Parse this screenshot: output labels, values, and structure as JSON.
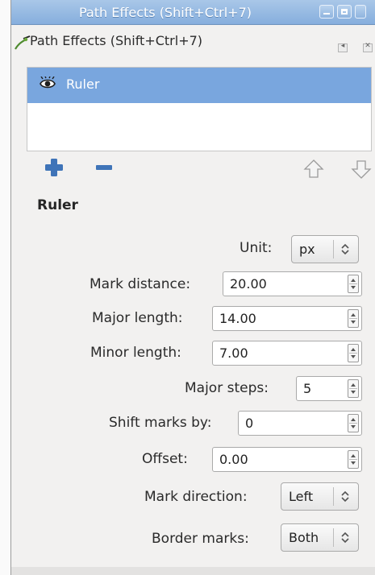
{
  "window": {
    "title": "Path Effects  (Shift+Ctrl+7)"
  },
  "dock": {
    "title": "Path Effects  (Shift+Ctrl+7)",
    "icon": "path-effects-icon"
  },
  "effects": {
    "items": [
      {
        "label": "Ruler",
        "visible": true,
        "selected": true
      }
    ]
  },
  "toolbar": {
    "add_icon": "plus-icon",
    "remove_icon": "minus-icon",
    "up_icon": "raise-icon",
    "down_icon": "lower-icon"
  },
  "section": {
    "title": "Ruler"
  },
  "params": {
    "unit": {
      "label": "Unit:",
      "value": "px"
    },
    "mark_distance": {
      "label": "Mark distance:",
      "value": "20.00"
    },
    "major_length": {
      "label": "Major length:",
      "value": "14.00"
    },
    "minor_length": {
      "label": "Minor length:",
      "value": "7.00"
    },
    "major_steps": {
      "label": "Major steps:",
      "value": "5"
    },
    "shift_marks": {
      "label": "Shift marks by:",
      "value": "0"
    },
    "offset": {
      "label": "Offset:",
      "value": "0.00"
    },
    "mark_direction": {
      "label": "Mark direction:",
      "value": "Left"
    },
    "border_marks": {
      "label": "Border marks:",
      "value": "Both"
    }
  },
  "colors": {
    "titlebar": "#94b8e2",
    "selection": "#79a6de",
    "accent": "#3f74b8"
  }
}
